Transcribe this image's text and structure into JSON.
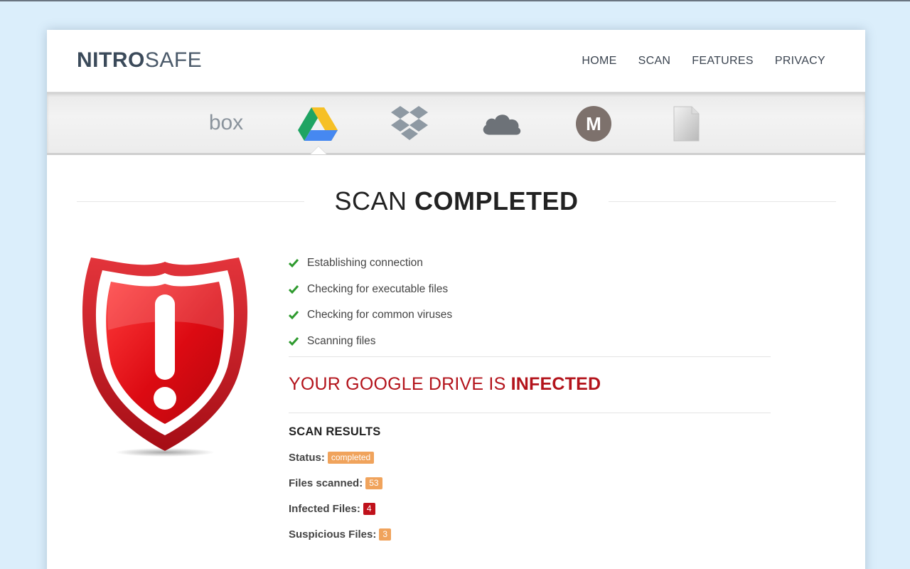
{
  "brand": {
    "bold": "NITRO",
    "light": "SAFE"
  },
  "nav": [
    "HOME",
    "SCAN",
    "FEATURES",
    "PRIVACY"
  ],
  "providers": [
    {
      "name": "box",
      "icon": "box-logo-icon",
      "label": "box"
    },
    {
      "name": "google-drive",
      "icon": "google-drive-icon",
      "selected": true
    },
    {
      "name": "dropbox",
      "icon": "dropbox-icon"
    },
    {
      "name": "onedrive",
      "icon": "onedrive-cloud-icon"
    },
    {
      "name": "mega",
      "icon": "mega-icon",
      "label": "M"
    },
    {
      "name": "file",
      "icon": "document-icon"
    }
  ],
  "title": {
    "thin": "SCAN",
    "strong": "COMPLETED"
  },
  "checks": [
    "Establishing connection",
    "Checking for executable files",
    "Checking for common viruses",
    "Scanning files"
  ],
  "infected": {
    "thin": "YOUR GOOGLE DRIVE IS ",
    "strong": "INFECTED"
  },
  "results": {
    "title": "SCAN RESULTS",
    "status_label": "Status:",
    "status_value": "completed",
    "files_scanned_label": "Files scanned:",
    "files_scanned_value": "53",
    "infected_label": "Infected Files:",
    "infected_value": "4",
    "suspicious_label": "Suspicious Files:",
    "suspicious_value": "3"
  },
  "colors": {
    "background": "#dbeefb",
    "brand": "#3b4a5a",
    "danger": "#b3131b",
    "check": "#2e9a2e",
    "badge_orange": "#f0a35c",
    "badge_red": "#c0111b"
  }
}
